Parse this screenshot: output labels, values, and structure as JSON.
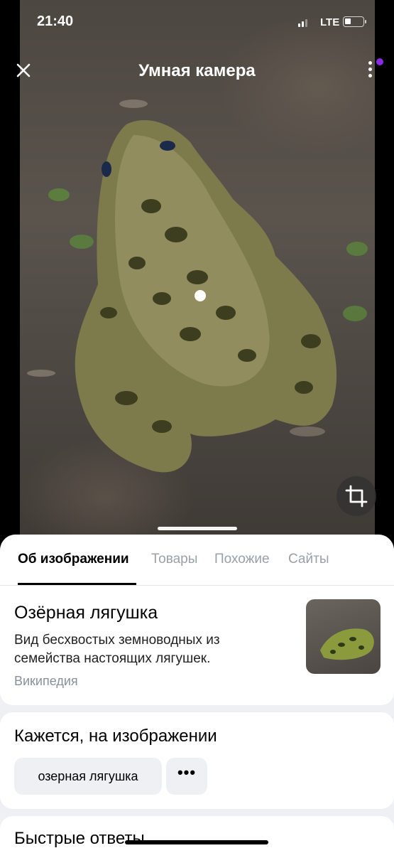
{
  "status_bar": {
    "time": "21:40",
    "network": "LTE"
  },
  "header": {
    "title": "Умная камера"
  },
  "tabs": [
    {
      "label": "Об изображении",
      "active": true
    },
    {
      "label": "Товары",
      "active": false
    },
    {
      "label": "Похожие",
      "active": false
    },
    {
      "label": "Сайты",
      "active": false
    }
  ],
  "result": {
    "title": "Озёрная лягушка",
    "description": "Вид бесхвостых земноводных из семейства настоящих лягушек.",
    "source": "Википедия"
  },
  "detected": {
    "title": "Кажется, на изображении",
    "chip_label": "озерная лягушка",
    "more_label": "•••"
  },
  "quick_answers": {
    "title": "Быстрые ответы"
  },
  "colors": {
    "accent_purple": "#8a2be2",
    "sheet_bg": "#eef0f3"
  },
  "icons": [
    "close-icon",
    "more-vertical-icon",
    "crop-icon"
  ]
}
